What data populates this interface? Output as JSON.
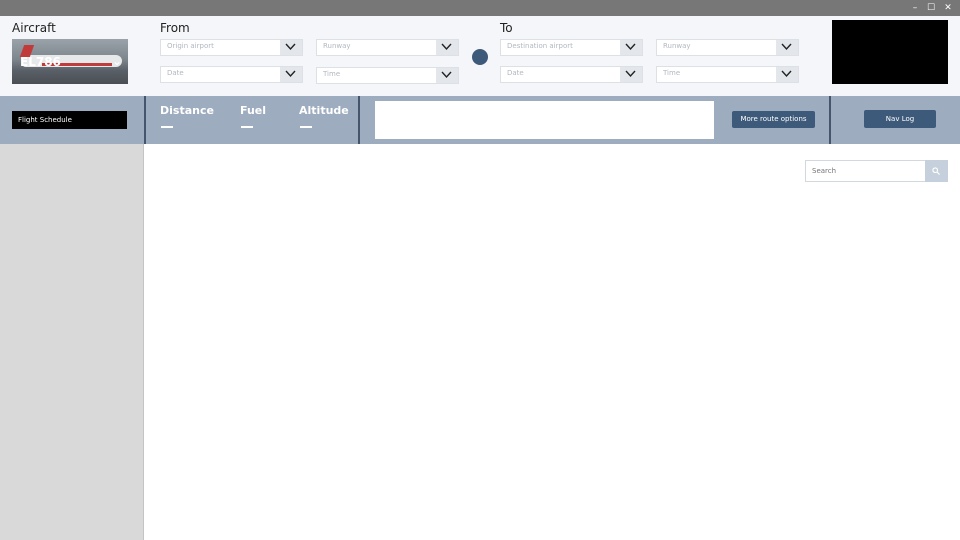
{
  "window": {
    "minimize": "–",
    "maximize": "☐",
    "close": "✕"
  },
  "header": {
    "aircraft_label": "Aircraft",
    "aircraft_name": "EL786",
    "from_label": "From",
    "to_label": "To",
    "from": {
      "airport_placeholder": "Origin airport",
      "runway_placeholder": "Runway",
      "date_placeholder": "Date",
      "time_placeholder": "Time"
    },
    "to": {
      "airport_placeholder": "Destination airport",
      "runway_placeholder": "Runway",
      "date_placeholder": "Date",
      "time_placeholder": "Time"
    }
  },
  "toolbar": {
    "flight_schedule": "Flight Schedule",
    "distance_label": "Distance",
    "fuel_label": "Fuel",
    "altitude_label": "Altitude",
    "more_route_options": "More route options",
    "nav_log": "Nav Log"
  },
  "search": {
    "placeholder": "Search"
  },
  "colors": {
    "accent": "#3e5a7a",
    "toolbar": "#9eacbf",
    "titlebar": "#777777"
  }
}
